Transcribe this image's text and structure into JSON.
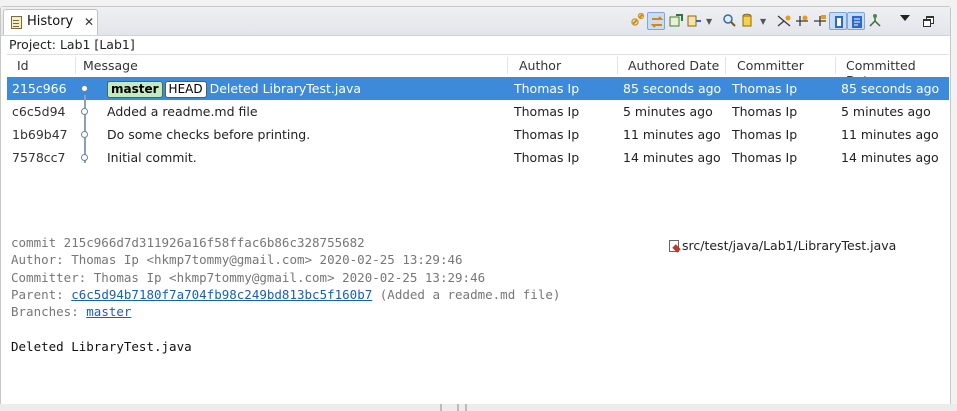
{
  "tab": {
    "title": "History",
    "close_glyph": "✕"
  },
  "project_line": "Project: Lab1 [Lab1]",
  "toolbar": {
    "icons": [
      "link-with-selection-icon",
      "show-all-branches-icon",
      "compare-mode-icon",
      "show-all-changes-icon",
      "filter-dropdown-icon",
      "search-icon",
      "show-repository-icon",
      "show-dropdown-icon",
      "show-first-parent-icon",
      "show-additional-refs-icon",
      "show-tags-icon",
      "show-branch-sequence-icon",
      "show-notes-icon",
      "show-commit-graph-icon"
    ]
  },
  "columns": [
    "Id",
    "Message",
    "Author",
    "Authored Date",
    "Committer",
    "Committed Date"
  ],
  "commits": [
    {
      "id": "215c966",
      "refs": [
        "master",
        "HEAD"
      ],
      "message": "Deleted LibraryTest.java",
      "author": "Thomas Ip",
      "authored": "85 seconds ago",
      "committer": "Thomas Ip",
      "committed": "85 seconds ago",
      "selected": true
    },
    {
      "id": "c6c5d94",
      "refs": [],
      "message": "Added a readme.md file",
      "author": "Thomas Ip",
      "authored": "5 minutes ago",
      "committer": "Thomas Ip",
      "committed": "5 minutes ago",
      "selected": false
    },
    {
      "id": "1b69b47",
      "refs": [],
      "message": "Do some checks before printing.",
      "author": "Thomas Ip",
      "authored": "11 minutes ago",
      "committer": "Thomas Ip",
      "committed": "11 minutes ago",
      "selected": false
    },
    {
      "id": "7578cc7",
      "refs": [],
      "message": "Initial commit.",
      "author": "Thomas Ip",
      "authored": "14 minutes ago",
      "committer": "Thomas Ip",
      "committed": "14 minutes ago",
      "selected": false
    }
  ],
  "details": {
    "commit_line": "commit 215c966d7d311926a16f58ffac6b86c328755682",
    "author_line": "Author: Thomas Ip <hkmp7tommy@gmail.com> 2020-02-25 13:29:46",
    "committer_line": "Committer: Thomas Ip <hkmp7tommy@gmail.com> 2020-02-25 13:29:46",
    "parent_prefix": "Parent: ",
    "parent_hash": "c6c5d94b7180f7a704fb98c249bd813bc5f160b7",
    "parent_suffix": " (Added a readme.md file)",
    "branches_prefix": "Branches: ",
    "branch": "master",
    "message": "Deleted LibraryTest.java"
  },
  "changed_files": [
    "src/test/java/Lab1/LibraryTest.java"
  ]
}
